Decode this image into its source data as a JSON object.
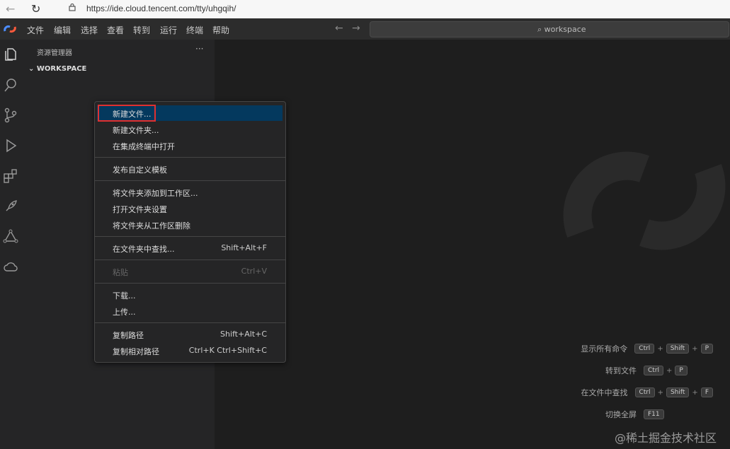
{
  "browser": {
    "url": "https://ide.cloud.tencent.com/tty/uhgqih/"
  },
  "menubar": {
    "items": [
      "文件",
      "编辑",
      "选择",
      "查看",
      "转到",
      "运行",
      "终端",
      "帮助"
    ],
    "command_center": "workspace"
  },
  "activity_bar": [
    "files-icon",
    "search-icon",
    "source-control-icon",
    "run-debug-icon",
    "extensions-icon",
    "rocket-icon",
    "triangle-nodes-icon",
    "cloud-icon"
  ],
  "sidebar": {
    "title": "资源管理器",
    "more": "···",
    "workspace": "WORKSPACE"
  },
  "context_menu": {
    "groups": [
      [
        {
          "label": "新建文件...",
          "key": ""
        },
        {
          "label": "新建文件夹...",
          "key": ""
        },
        {
          "label": "在集成终端中打开",
          "key": ""
        }
      ],
      [
        {
          "label": "发布自定义模板",
          "key": ""
        }
      ],
      [
        {
          "label": "将文件夹添加到工作区...",
          "key": ""
        },
        {
          "label": "打开文件夹设置",
          "key": ""
        },
        {
          "label": "将文件夹从工作区删除",
          "key": ""
        }
      ],
      [
        {
          "label": "在文件夹中查找...",
          "key": "Shift+Alt+F"
        }
      ],
      [
        {
          "label": "粘贴",
          "key": "Ctrl+V"
        }
      ],
      [
        {
          "label": "下载...",
          "key": ""
        },
        {
          "label": "上传...",
          "key": ""
        }
      ],
      [
        {
          "label": "复制路径",
          "key": "Shift+Alt+C"
        },
        {
          "label": "复制相对路径",
          "key": "Ctrl+K Ctrl+Shift+C"
        }
      ]
    ]
  },
  "shortcuts": [
    {
      "label": "显示所有命令",
      "keys": [
        "Ctrl",
        "Shift",
        "P"
      ]
    },
    {
      "label": "转到文件",
      "keys": [
        "Ctrl",
        "P"
      ]
    },
    {
      "label": "在文件中查找",
      "keys": [
        "Ctrl",
        "Shift",
        "F"
      ]
    },
    {
      "label": "切换全屏",
      "keys": [
        "F11"
      ]
    }
  ],
  "watermark": "@稀土掘金技术社区",
  "colors": {
    "accent": "#04395e",
    "highlight_border": "#e03030"
  }
}
